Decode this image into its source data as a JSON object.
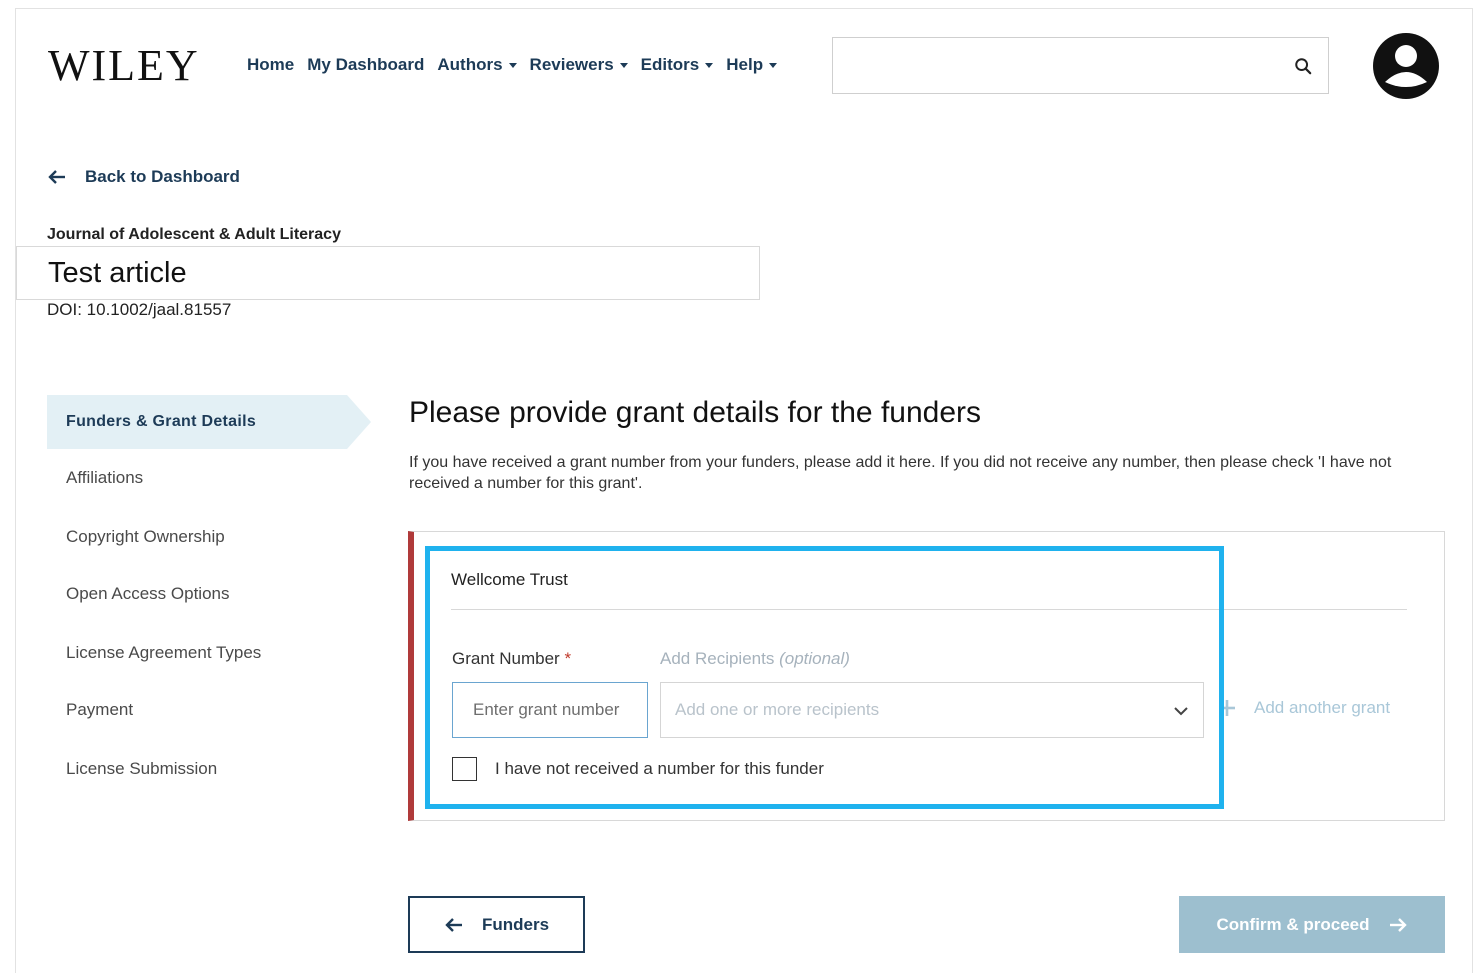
{
  "header": {
    "logo": "WILEY",
    "nav": [
      {
        "label": "Home",
        "dropdown": false
      },
      {
        "label": "My Dashboard",
        "dropdown": false
      },
      {
        "label": "Authors",
        "dropdown": true
      },
      {
        "label": "Reviewers",
        "dropdown": true
      },
      {
        "label": "Editors",
        "dropdown": true
      },
      {
        "label": "Help",
        "dropdown": true
      }
    ],
    "search_value": "",
    "icons": {
      "search": "search-icon",
      "user": "user-avatar-icon"
    }
  },
  "back_link": "Back to Dashboard",
  "article": {
    "journal": "Journal of Adolescent & Adult Literacy",
    "title": "Test article",
    "doi": "DOI: 10.1002/jaal.81557"
  },
  "sidebar": {
    "items": [
      {
        "label": "Funders & Grant Details",
        "active": true
      },
      {
        "label": "Affiliations",
        "active": false
      },
      {
        "label": "Copyright Ownership",
        "active": false
      },
      {
        "label": "Open Access Options",
        "active": false
      },
      {
        "label": "License Agreement Types",
        "active": false
      },
      {
        "label": "Payment",
        "active": false
      },
      {
        "label": "License Submission",
        "active": false
      }
    ]
  },
  "main": {
    "heading": "Please provide grant details for the funders",
    "description": "If you have received a grant number from your funders, please add it here. If you did not receive any number, then please check 'I have not received a number for this grant'.",
    "funder": {
      "name": "Wellcome Trust",
      "grant_label": "Grant Number",
      "required_mark": "*",
      "grant_placeholder": "Enter grant number",
      "recipients_label": "Add Recipients",
      "recipients_optional": "(optional)",
      "recipients_placeholder": "Add one or more recipients",
      "add_grant": "Add another grant",
      "no_number_label": "I have not received a number for this funder",
      "no_number_checked": false
    }
  },
  "footer": {
    "back_button": "Funders",
    "confirm_button": "Confirm & proceed"
  },
  "colors": {
    "brand_navy": "#1d3b57",
    "active_bg": "#e3f0f5",
    "card_accent": "#b03a3a",
    "highlight": "#1fb2ee",
    "confirm_disabled": "#9dbfcf"
  }
}
